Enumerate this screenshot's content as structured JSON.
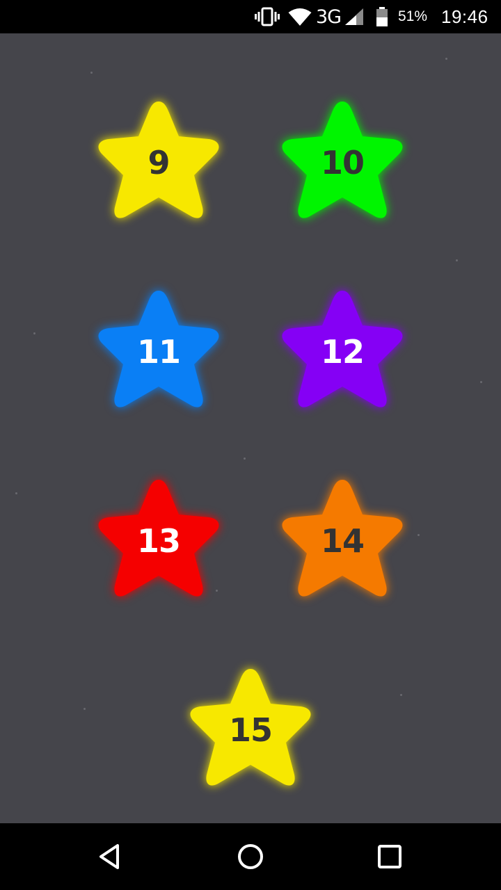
{
  "status_bar": {
    "network_type": "3G",
    "battery_percent": "51%",
    "time": "19:46",
    "icons": [
      "vibrate-icon",
      "wifi-icon",
      "cell-signal-icon",
      "battery-icon"
    ]
  },
  "levels": [
    {
      "number": "9",
      "color": "#f7e800",
      "text_color": "#333333"
    },
    {
      "number": "10",
      "color": "#00f500",
      "text_color": "#333333"
    },
    {
      "number": "11",
      "color": "#0a7ff5",
      "text_color": "#ffffff"
    },
    {
      "number": "12",
      "color": "#8500f5",
      "text_color": "#ffffff"
    },
    {
      "number": "13",
      "color": "#f50000",
      "text_color": "#ffffff"
    },
    {
      "number": "14",
      "color": "#f57a00",
      "text_color": "#333333"
    },
    {
      "number": "15",
      "color": "#f7e800",
      "text_color": "#333333"
    }
  ],
  "background_color": "#45454b",
  "nav_bar": {
    "icons": [
      "back-icon",
      "home-icon",
      "recents-icon"
    ]
  }
}
